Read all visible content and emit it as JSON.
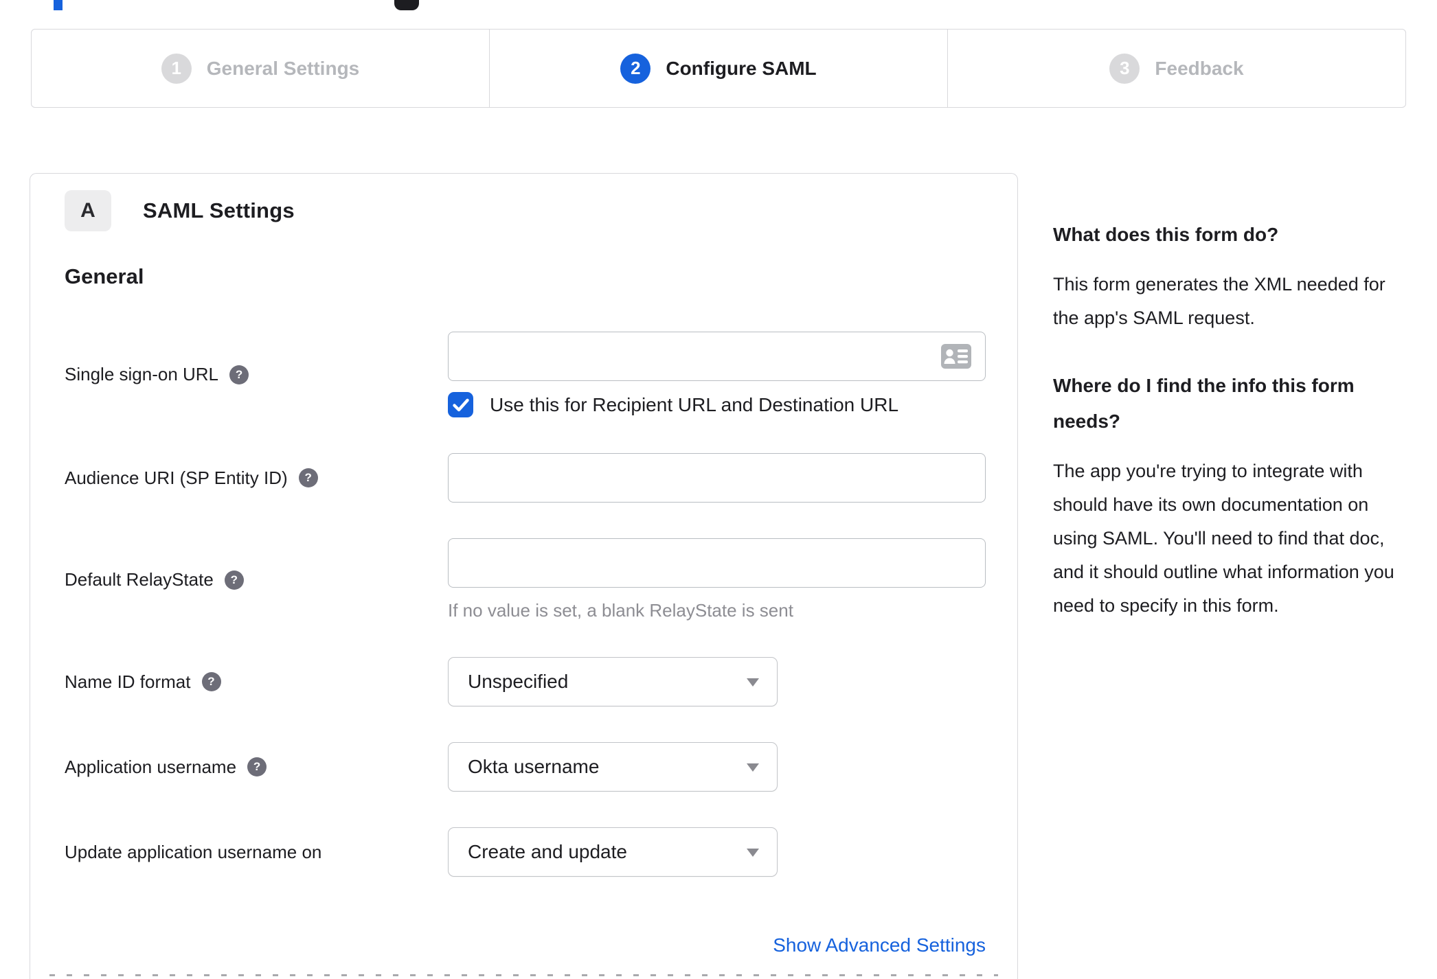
{
  "colors": {
    "accent": "#1662dd",
    "inactive_step": "#b5b7bb",
    "border": "#d8d8dc",
    "help_icon_bg": "#6d6d78",
    "hint_text": "#8d8d93"
  },
  "icons": {
    "help": "?",
    "contact_card": "contact-card-icon",
    "checkmark": "check-icon",
    "caret": "chevron-down-icon"
  },
  "stepper": {
    "steps": [
      {
        "number": "1",
        "label": "General Settings",
        "state": "inactive"
      },
      {
        "number": "2",
        "label": "Configure SAML",
        "state": "active"
      },
      {
        "number": "3",
        "label": "Feedback",
        "state": "inactive"
      }
    ]
  },
  "panel": {
    "section_badge": "A",
    "section_title": "SAML Settings",
    "group_title": "General",
    "fields": [
      {
        "label": "Single sign-on URL",
        "type": "text",
        "value": "",
        "checkbox_label": "Use this for Recipient URL and Destination URL",
        "checkbox_checked": true
      },
      {
        "label": "Audience URI (SP Entity ID)",
        "type": "text",
        "value": ""
      },
      {
        "label": "Default RelayState",
        "type": "text",
        "value": "",
        "hint": "If no value is set, a blank RelayState is sent"
      },
      {
        "label": "Name ID format",
        "type": "select",
        "value": "Unspecified"
      },
      {
        "label": "Application username",
        "type": "select",
        "value": "Okta username"
      },
      {
        "label": "Update application username on",
        "type": "select",
        "value": "Create and update"
      }
    ],
    "advanced_link": "Show Advanced Settings"
  },
  "sidebar": {
    "heading1": "What does this form do?",
    "para1": "This form generates the XML needed for the app's SAML request.",
    "heading2": "Where do I find the info this form needs?",
    "para2": "The app you're trying to integrate with should have its own documentation on using SAML. You'll need to find that doc, and it should outline what information you need to specify in this form."
  }
}
